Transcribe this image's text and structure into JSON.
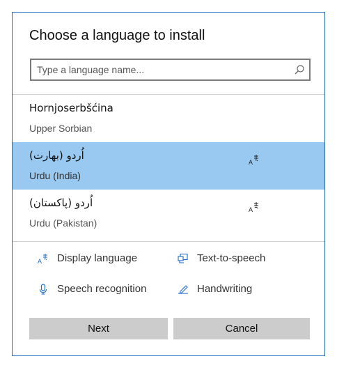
{
  "dialog": {
    "title": "Choose a language to install",
    "search_placeholder": "Type a language name..."
  },
  "languages": [
    {
      "native": "Hornjoserbšćina",
      "english": "Upper Sorbian",
      "selected": false,
      "icons": []
    },
    {
      "native": "اُردو (بھارت)",
      "english": "Urdu (India)",
      "selected": true,
      "icons": [
        "display-language-icon"
      ]
    },
    {
      "native": "اُردو (پاکستان)",
      "english": "Urdu (Pakistan)",
      "selected": false,
      "icons": [
        "display-language-icon"
      ]
    }
  ],
  "features": [
    {
      "label": "Display language",
      "icon": "display-language-icon"
    },
    {
      "label": "Text-to-speech",
      "icon": "text-to-speech-icon"
    },
    {
      "label": "Speech recognition",
      "icon": "microphone-icon"
    },
    {
      "label": "Handwriting",
      "icon": "handwriting-icon"
    }
  ],
  "buttons": {
    "next": "Next",
    "cancel": "Cancel"
  },
  "colors": {
    "accent": "#1e6cc8",
    "selection": "#99c9f1",
    "button": "#cccccc"
  }
}
